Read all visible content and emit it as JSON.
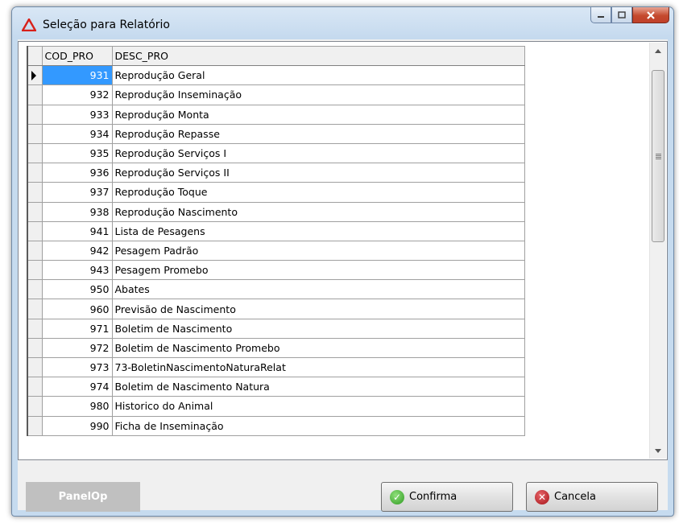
{
  "window": {
    "title": "Seleção para Relatório",
    "icon": "red-triangle-icon"
  },
  "grid": {
    "columns": [
      "COD_PRO",
      "DESC_PRO"
    ],
    "selected_row_index": 0,
    "rows": [
      {
        "code": "931",
        "desc": "Reprodução Geral"
      },
      {
        "code": "932",
        "desc": "Reprodução Inseminação"
      },
      {
        "code": "933",
        "desc": "Reprodução Monta"
      },
      {
        "code": "934",
        "desc": "Reprodução Repasse"
      },
      {
        "code": "935",
        "desc": "Reprodução Serviços I"
      },
      {
        "code": "936",
        "desc": "Reprodução Serviços II"
      },
      {
        "code": "937",
        "desc": "Reprodução Toque"
      },
      {
        "code": "938",
        "desc": "Reprodução Nascimento"
      },
      {
        "code": "941",
        "desc": "Lista de Pesagens"
      },
      {
        "code": "942",
        "desc": "Pesagem Padrão"
      },
      {
        "code": "943",
        "desc": "Pesagem Promebo"
      },
      {
        "code": "950",
        "desc": "Abates"
      },
      {
        "code": "960",
        "desc": "Previsão de Nascimento"
      },
      {
        "code": "971",
        "desc": "Boletim de Nascimento"
      },
      {
        "code": "972",
        "desc": "Boletim de Nascimento Promebo"
      },
      {
        "code": "973",
        "desc": "73-BoletinNascimentoNaturaRelat"
      },
      {
        "code": "974",
        "desc": "Boletim de Nascimento Natura"
      },
      {
        "code": "980",
        "desc": "Historico do Animal"
      },
      {
        "code": "990",
        "desc": "Ficha de Inseminação"
      }
    ]
  },
  "footer": {
    "panel_label": "PanelOp",
    "confirm_label": "Confirma",
    "cancel_label": "Cancela"
  },
  "colors": {
    "selection": "#3399ff",
    "confirm_icon": "#2f9a22",
    "cancel_icon": "#a41217",
    "close_button": "#c44a2e"
  }
}
